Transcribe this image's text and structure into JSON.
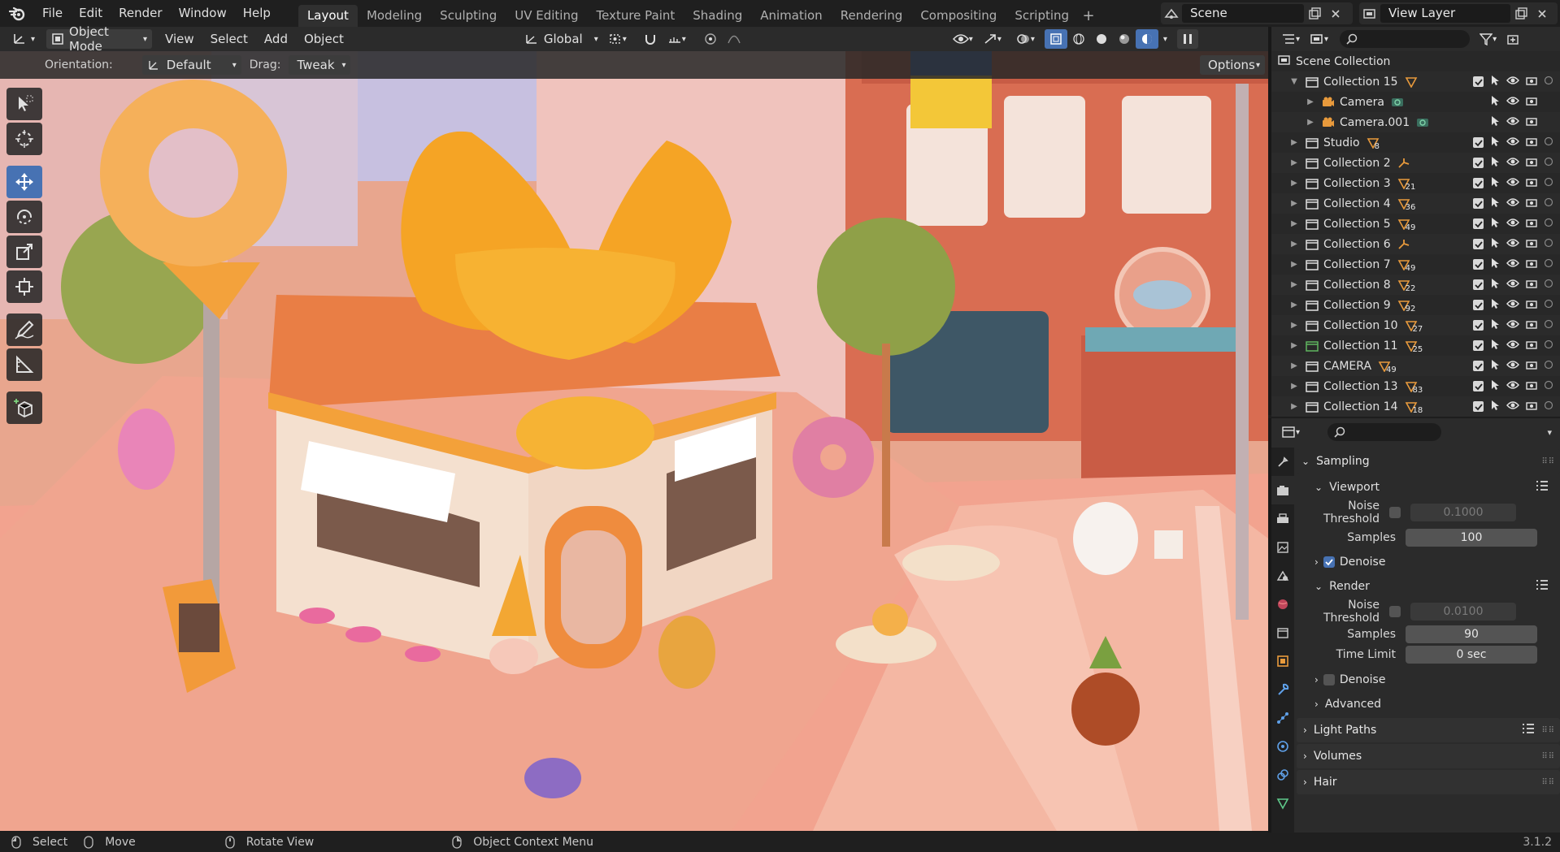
{
  "app": {
    "name": "Blender",
    "version": "3.1.2"
  },
  "menu": [
    "File",
    "Edit",
    "Render",
    "Window",
    "Help"
  ],
  "workspaces": [
    "Layout",
    "Modeling",
    "Sculpting",
    "UV Editing",
    "Texture Paint",
    "Shading",
    "Animation",
    "Rendering",
    "Compositing",
    "Scripting"
  ],
  "active_workspace": "Layout",
  "scene": "Scene",
  "view_layer": "View Layer",
  "viewport_header": {
    "mode": "Object Mode",
    "menus": [
      "View",
      "Select",
      "Add",
      "Object"
    ],
    "transform_orientation": "Global"
  },
  "tool_header": {
    "orientation_label": "Orientation:",
    "orientation_value": "Default",
    "drag_label": "Drag:",
    "drag_value": "Tweak",
    "options": "Options"
  },
  "tools": [
    "select-box",
    "cursor",
    "move",
    "rotate",
    "scale",
    "transform",
    "annotate",
    "measure",
    "add-cube"
  ],
  "active_tool": "move",
  "outliner": {
    "root": "Scene Collection",
    "rows": [
      {
        "name": "Collection 15",
        "indent": 1,
        "expanded": true,
        "badge": ""
      },
      {
        "name": "Camera",
        "indent": 2,
        "expanded": false,
        "badge": ""
      },
      {
        "name": "Camera.001",
        "indent": 2,
        "expanded": false,
        "badge": ""
      },
      {
        "name": "Studio",
        "indent": 1,
        "expanded": false,
        "badge": "8"
      },
      {
        "name": "Collection 2",
        "indent": 1,
        "expanded": false,
        "badge": ""
      },
      {
        "name": "Collection 3",
        "indent": 1,
        "expanded": false,
        "badge": "21"
      },
      {
        "name": "Collection 4",
        "indent": 1,
        "expanded": false,
        "badge": "36"
      },
      {
        "name": "Collection 5",
        "indent": 1,
        "expanded": false,
        "badge": "49"
      },
      {
        "name": "Collection 6",
        "indent": 1,
        "expanded": false,
        "badge": ""
      },
      {
        "name": "Collection 7",
        "indent": 1,
        "expanded": false,
        "badge": "49"
      },
      {
        "name": "Collection 8",
        "indent": 1,
        "expanded": false,
        "badge": "22"
      },
      {
        "name": "Collection 9",
        "indent": 1,
        "expanded": false,
        "badge": "92"
      },
      {
        "name": "Collection 10",
        "indent": 1,
        "expanded": false,
        "badge": "27"
      },
      {
        "name": "Collection 11",
        "indent": 1,
        "expanded": false,
        "badge": "25"
      },
      {
        "name": "CAMERA",
        "indent": 1,
        "expanded": false,
        "badge": "49"
      },
      {
        "name": "Collection 13",
        "indent": 1,
        "expanded": false,
        "badge": "83"
      },
      {
        "name": "Collection 14",
        "indent": 1,
        "expanded": false,
        "badge": "18"
      }
    ]
  },
  "properties": {
    "sampling": "Sampling",
    "viewport": "Viewport",
    "viewport_noise_label": "Noise Threshold",
    "viewport_noise_value": "0.1000",
    "viewport_samples_label": "Samples",
    "viewport_samples_value": "100",
    "viewport_denoise": "Denoise",
    "render": "Render",
    "render_noise_label": "Noise Threshold",
    "render_noise_value": "0.0100",
    "render_samples_label": "Samples",
    "render_samples_value": "90",
    "time_limit_label": "Time Limit",
    "time_limit_value": "0 sec",
    "render_denoise": "Denoise",
    "advanced": "Advanced",
    "light_paths": "Light Paths",
    "volumes": "Volumes",
    "hair": "Hair"
  },
  "statusbar": {
    "select": "Select",
    "move": "Move",
    "rotate": "Rotate View",
    "context": "Object Context Menu",
    "version": "3.1.2"
  },
  "colors": {
    "accent": "#4772b3",
    "orange": "#e89a3c",
    "collection_white": "#e0e0e0",
    "collection_green": "#5fb55f"
  }
}
